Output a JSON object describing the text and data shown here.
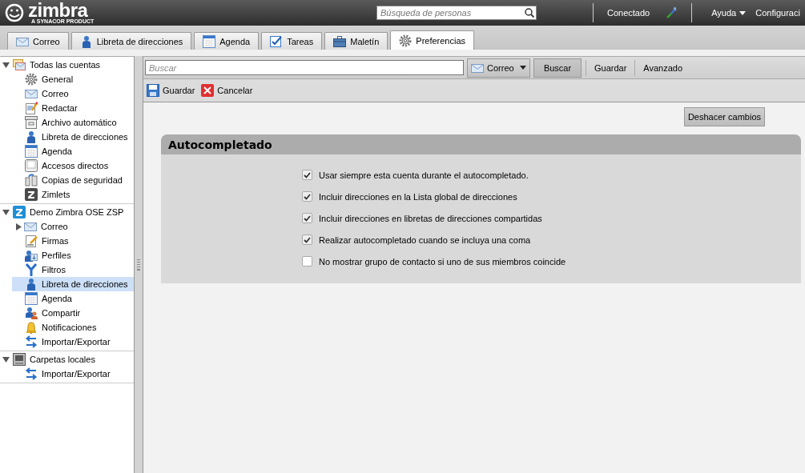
{
  "header": {
    "logo": {
      "name": "zimbra",
      "tagline": "A SYNACOR PRODUCT"
    },
    "search": {
      "placeholder": "Búsqueda de personas"
    },
    "status": "Conectado",
    "help": "Ayuda",
    "settings": "Configuraci"
  },
  "tabs": [
    {
      "label": "Correo",
      "selected": false
    },
    {
      "label": "Libreta de direcciones",
      "selected": false
    },
    {
      "label": "Agenda",
      "selected": false
    },
    {
      "label": "Tareas",
      "selected": false
    },
    {
      "label": "Maletín",
      "selected": false
    },
    {
      "label": "Preferencias",
      "selected": true
    }
  ],
  "sidebar": {
    "sections": [
      {
        "label": "Todas las cuentas",
        "expanded": true,
        "items": [
          {
            "label": "General",
            "selected": false
          },
          {
            "label": "Correo",
            "selected": false
          },
          {
            "label": "Redactar",
            "selected": false
          },
          {
            "label": "Archivo automático",
            "selected": false
          },
          {
            "label": "Libreta de direcciones",
            "selected": false
          },
          {
            "label": "Agenda",
            "selected": false
          },
          {
            "label": "Accesos directos",
            "selected": false
          },
          {
            "label": "Copias de seguridad",
            "selected": false
          },
          {
            "label": "Zimlets",
            "selected": false
          }
        ]
      },
      {
        "label": "Demo Zimbra OSE ZSP",
        "expanded": true,
        "items": [
          {
            "label": "Correo",
            "selected": false,
            "expanded": false
          },
          {
            "label": "Firmas",
            "selected": false
          },
          {
            "label": "Perfiles",
            "selected": false
          },
          {
            "label": "Filtros",
            "selected": false
          },
          {
            "label": "Libreta de direcciones",
            "selected": true
          },
          {
            "label": "Agenda",
            "selected": false
          },
          {
            "label": "Compartir",
            "selected": false
          },
          {
            "label": "Notificaciones",
            "selected": false
          },
          {
            "label": "Importar/Exportar",
            "selected": false
          }
        ]
      },
      {
        "label": "Carpetas locales",
        "expanded": true,
        "items": [
          {
            "label": "Importar/Exportar",
            "selected": false
          }
        ]
      }
    ]
  },
  "searchbar": {
    "placeholder": "Buscar",
    "scope": "Correo",
    "search_button": "Buscar",
    "links": [
      "Guardar",
      "Avanzado"
    ]
  },
  "actions": [
    "Guardar",
    "Cancelar"
  ],
  "undo_button": "Deshacer cambios",
  "panel": {
    "title": "Autocompletado",
    "options": [
      {
        "label": "Usar siempre esta cuenta durante el autocompletado.",
        "checked": true
      },
      {
        "label": "Incluir direcciones en la Lista global de direcciones",
        "checked": true
      },
      {
        "label": "Incluir direcciones en libretas de direcciones compartidas",
        "checked": true
      },
      {
        "label": "Realizar autocompletado cuando se incluya una coma",
        "checked": true
      },
      {
        "label": "No mostrar grupo de contacto si uno de sus miembros coincide",
        "checked": false
      }
    ]
  }
}
